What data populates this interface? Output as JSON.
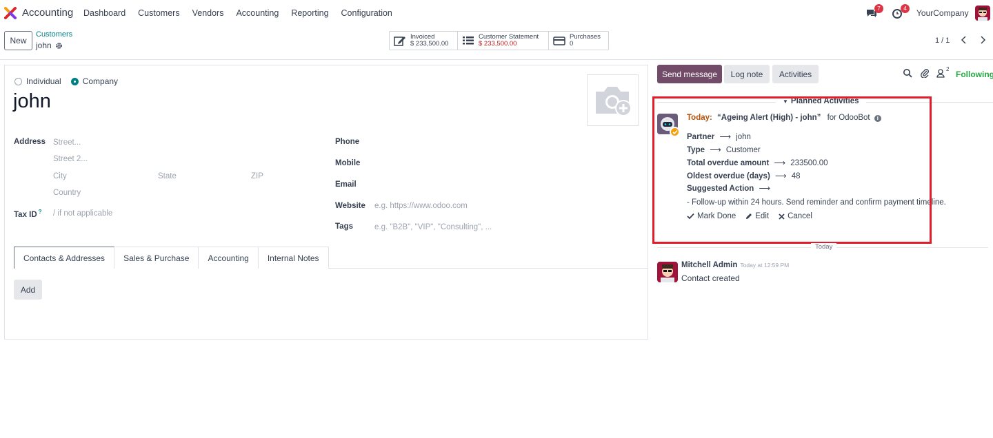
{
  "navbar": {
    "app_name": "Accounting",
    "menu": [
      "Dashboard",
      "Customers",
      "Vendors",
      "Accounting",
      "Reporting",
      "Configuration"
    ],
    "messages_count": "7",
    "activities_count": "4",
    "company": "YourCompany"
  },
  "control": {
    "new_label": "New",
    "breadcrumb_parent": "Customers",
    "breadcrumb_current": "john",
    "smart_buttons": [
      {
        "label": "Invoiced",
        "value": "$ 233,500.00",
        "icon": "pencil-square-icon"
      },
      {
        "label": "Customer Statement",
        "value": "$ 233,500.00",
        "icon": "list-icon"
      },
      {
        "label": "Purchases",
        "value": "0",
        "icon": "credit-card-icon"
      }
    ],
    "pager": "1 / 1"
  },
  "form": {
    "type_individual": "Individual",
    "type_company": "Company",
    "name": "john",
    "address_label": "Address",
    "street_ph": "Street...",
    "street2_ph": "Street 2...",
    "city_ph": "City",
    "state_ph": "State",
    "zip_ph": "ZIP",
    "country_ph": "Country",
    "taxid_label": "Tax ID",
    "taxid_help": "?",
    "taxid_ph": "/ if not applicable",
    "phone_label": "Phone",
    "mobile_label": "Mobile",
    "email_label": "Email",
    "website_label": "Website",
    "website_ph": "e.g. https://www.odoo.com",
    "tags_label": "Tags",
    "tags_ph": "e.g. \"B2B\", \"VIP\", \"Consulting\", ...",
    "tabs": [
      "Contacts & Addresses",
      "Sales & Purchase",
      "Accounting",
      "Internal Notes"
    ],
    "add_label": "Add"
  },
  "chatter": {
    "send_message": "Send message",
    "log_note": "Log note",
    "activities": "Activities",
    "followers_count": "2",
    "following": "Following",
    "planned_title": "Planned Activities",
    "activity": {
      "today": "Today:",
      "summary": "“Ageing Alert (High) - john”",
      "for_user": "for OdooBot",
      "partner_label": "Partner",
      "partner_value": "john",
      "type_label": "Type",
      "type_value": "Customer",
      "overdue_label": "Total overdue amount",
      "overdue_value": "233500.00",
      "oldest_label": "Oldest overdue (days)",
      "oldest_value": "48",
      "suggested_label": "Suggested Action",
      "suggested_text": "- Follow-up within 24 hours. Send reminder and confirm payment timeline.",
      "mark_done": "Mark Done",
      "edit": "Edit",
      "cancel": "Cancel"
    },
    "arrow": "⟶",
    "today_sep": "Today",
    "message": {
      "author": "Mitchell Admin",
      "time": "Today at 12:59 PM",
      "body": "Contact created"
    }
  }
}
